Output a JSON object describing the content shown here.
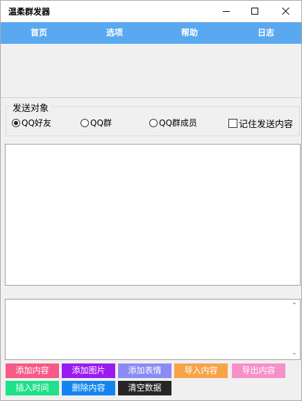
{
  "window": {
    "title": "温柔群发器"
  },
  "menu": {
    "items": [
      "首页",
      "选项",
      "帮助",
      "日志"
    ],
    "color": "#5aa8f0"
  },
  "target_group": {
    "legend": "发送对象",
    "options": [
      {
        "label": "QQ好友",
        "checked": true
      },
      {
        "label": "QQ群",
        "checked": false
      },
      {
        "label": "QQ群成员",
        "checked": false
      }
    ],
    "remember_checkbox": {
      "label": "记住发送内容",
      "checked": false
    }
  },
  "buttons": [
    {
      "label": "添加内容",
      "color": "#f65a86"
    },
    {
      "label": "添加图片",
      "color": "#9a1bf0"
    },
    {
      "label": "添加表情",
      "color": "#8b8bf6"
    },
    {
      "label": "导入内容",
      "color": "#f8a348"
    },
    {
      "label": "导出内容",
      "color": "#f78fc8"
    },
    {
      "label": "插入时间",
      "color": "#20e08a"
    },
    {
      "label": "删除内容",
      "color": "#1485f0"
    },
    {
      "label": "清空数据",
      "color": "#262626"
    }
  ]
}
